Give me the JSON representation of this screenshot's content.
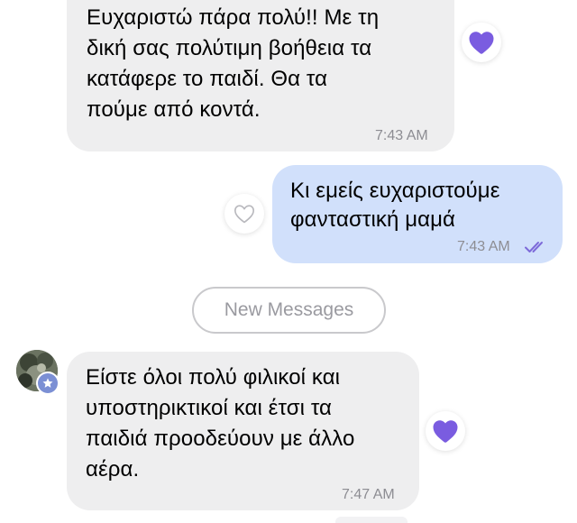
{
  "chat": {
    "messages": [
      {
        "direction": "incoming",
        "lines": [
          "Ευχαριστώ πάρα πολύ!! Με τη",
          "δική σας πολύτιμη βοήθεια τα",
          "κατάφερε το παιδί. Θα τα",
          "πούμε από κοντά."
        ],
        "time": "7:43 AM",
        "reaction": "purple-heart-icon",
        "reacted": true
      },
      {
        "direction": "outgoing",
        "lines": [
          "Κι εμείς ευχαριστούμε",
          "φανταστική μαμά"
        ],
        "time": "7:43 AM",
        "status": "read-double-check-icon",
        "reaction": "heart-outline-icon",
        "reacted": false
      },
      {
        "direction": "incoming",
        "lines": [
          "Είστε όλοι πολύ φιλικοί και",
          "υποστηρικτικοί και έτσι τα",
          "παιδιά προοδεύουν με άλλο",
          "αέρα."
        ],
        "time": "7:47 AM",
        "reaction": "purple-heart-icon",
        "reacted": true
      }
    ],
    "separator_label": "New Messages"
  },
  "colors": {
    "incoming_bubble": "#eeeeef",
    "outgoing_bubble": "#d1e0fb",
    "heart_filled": "#7a5ce0",
    "read_checks": "#7d6ad9",
    "timestamp": "#8d8d93",
    "separator_text": "#9a9aa0"
  }
}
